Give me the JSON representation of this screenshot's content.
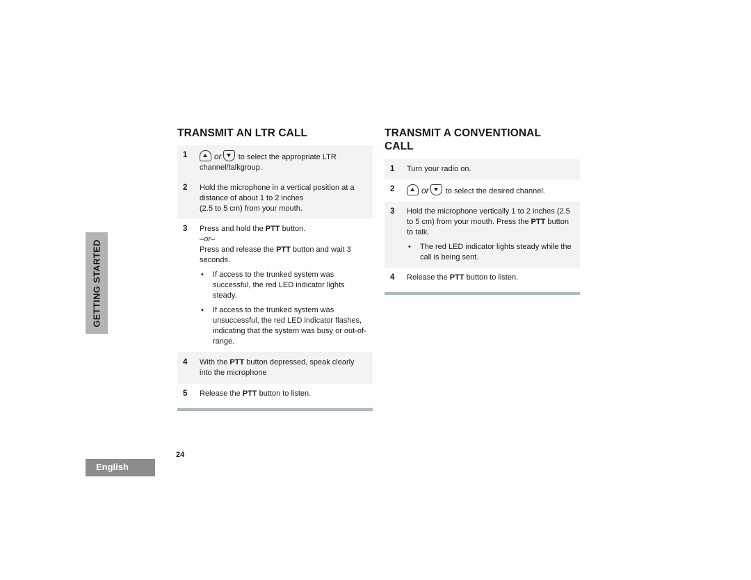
{
  "side_tab": {
    "label": "GETTING STARTED"
  },
  "language_tab": {
    "label": "English"
  },
  "page_number": "24",
  "icons": {
    "up_key": "up-arrow-key-icon",
    "down_key": "down-arrow-key-icon"
  },
  "colors": {
    "shade": "#f1f3f5",
    "rule": "#a7bbc4",
    "side_tab": "#b4b4b4",
    "language_tab": "#8c8c8c"
  },
  "left": {
    "title": "TRANSMIT AN LTR CALL",
    "steps": [
      {
        "num": "1",
        "or": "or",
        "text": "to select the appropriate LTR channel/talkgroup."
      },
      {
        "num": "2",
        "line1": "Hold the microphone in a vertical position at a distance of about 1 to 2 inches",
        "line2": "(2.5 to 5 cm) from your mouth."
      },
      {
        "num": "3",
        "a_pre": "Press and hold the ",
        "a_bold": "PTT",
        "a_post": " button.",
        "or": "–or–",
        "b_pre": "Press and release the ",
        "b_bold": "PTT",
        "b_post": " button and wait 3 seconds.",
        "bullets": [
          "If access to the trunked system was successful, the red LED indicator lights steady.",
          "If access to the trunked system was unsuccessful, the red LED indicator flashes, indicating that the system was busy or out-of-range."
        ]
      },
      {
        "num": "4",
        "pre": "With the ",
        "bold": "PTT",
        "post": " button depressed, speak clearly into the microphone"
      },
      {
        "num": "5",
        "pre": "Release the ",
        "bold": "PTT",
        "post": " button to listen."
      }
    ]
  },
  "right": {
    "title": "TRANSMIT A CONVENTIONAL CALL",
    "steps": [
      {
        "num": "1",
        "text": "Turn your radio on."
      },
      {
        "num": "2",
        "or": "or",
        "text": "to select the desired channel."
      },
      {
        "num": "3",
        "pre": "Hold the microphone vertically 1 to 2 inches (2.5 to 5 cm) from your mouth. Press the ",
        "bold": "PTT",
        "post": " button to talk.",
        "bullets": [
          "The red LED indicator lights steady while the call is being sent."
        ]
      },
      {
        "num": "4",
        "pre": "Release the ",
        "bold": "PTT",
        "post": " button to listen."
      }
    ]
  }
}
